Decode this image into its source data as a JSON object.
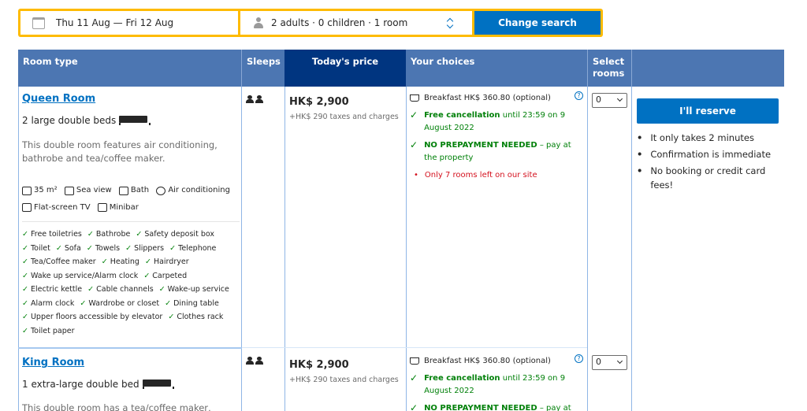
{
  "search": {
    "dates": "Thu 11 Aug — Fri 12 Aug",
    "guests": "2 adults · 0 children · 1 room",
    "button": "Change search"
  },
  "table_header": {
    "room_type": "Room type",
    "sleeps": "Sleeps",
    "todays_price": "Today's price",
    "your_choices": "Your choices",
    "select_rooms_1": "Select",
    "select_rooms_2": "rooms"
  },
  "rooms": [
    {
      "name": "Queen Room",
      "beds": "2 large double beds",
      "description": "This double room features air conditioning, bathrobe and tea/coffee maker.",
      "facilities": [
        "35 m²",
        "Sea view",
        "Bath",
        "Air conditioning",
        "Flat-screen TV",
        "Minibar"
      ],
      "amenities": [
        "Free toiletries",
        "Bathrobe",
        "Safety deposit box",
        "Toilet",
        "Sofa",
        "Towels",
        "Slippers",
        "Telephone",
        "Tea/Coffee maker",
        "Heating",
        "Hairdryer",
        "Wake up service/Alarm clock",
        "Carpeted",
        "Electric kettle",
        "Cable channels",
        "Wake-up service",
        "Alarm clock",
        "Wardrobe or closet",
        "Dining table",
        "Upper floors accessible by elevator",
        "Clothes rack",
        "Toilet paper"
      ],
      "price": "HK$ 2,900",
      "taxes": "+HK$ 290 taxes and charges",
      "breakfast": "Breakfast HK$ 360.80 (optional)",
      "free_cancellation": "Free cancellation",
      "cancellation_until": " until 23:59 on 9 August 2022",
      "no_prepayment": "NO PREPAYMENT NEEDED",
      "no_prepayment_rest": " – pay at the property",
      "rooms_left": "Only 7 rooms left on our site",
      "select_value": "0"
    },
    {
      "name": "King Room",
      "beds": "1 extra-large double bed",
      "description": "This double room has a tea/coffee maker,",
      "price": "HK$ 2,900",
      "taxes": "+HK$ 290 taxes and charges",
      "breakfast": "Breakfast HK$ 360.80 (optional)",
      "free_cancellation": "Free cancellation",
      "cancellation_until": " until 23:59 on 9 August 2022",
      "no_prepayment": "NO PREPAYMENT NEEDED",
      "no_prepayment_rest": " – pay at the",
      "select_value": "0"
    }
  ],
  "reserve": {
    "button": "I'll reserve",
    "benefits": [
      "It only takes 2 minutes",
      "Confirmation is immediate",
      "No booking or credit card fees!"
    ]
  },
  "colors": {
    "brand_blue": "#0071c2",
    "header_blue": "#4c76b2",
    "dark_blue": "#003580",
    "accent_yellow": "#febb02",
    "green": "#008009",
    "red": "#d4111e"
  }
}
